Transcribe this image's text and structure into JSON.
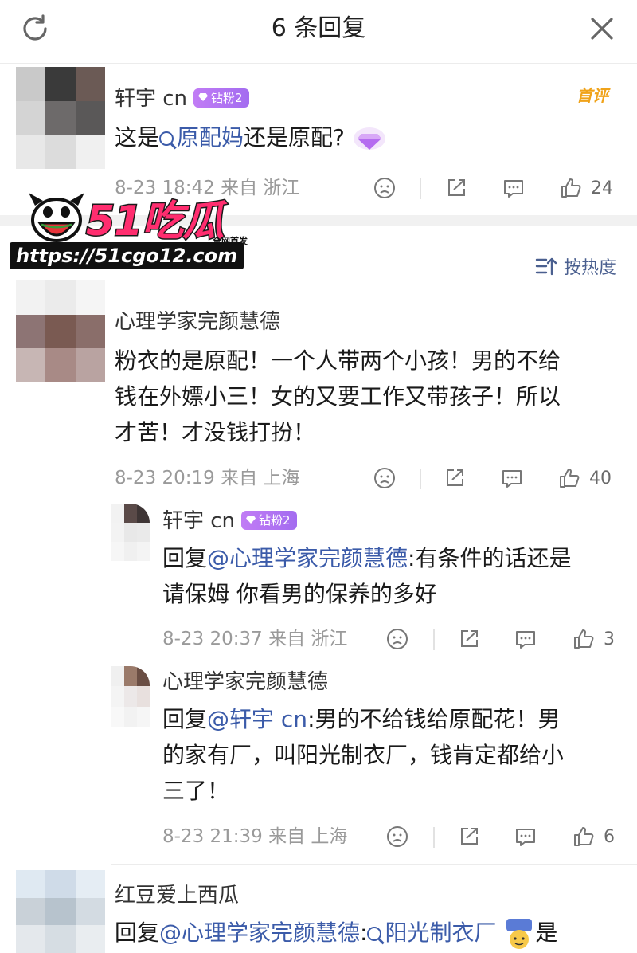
{
  "header": {
    "title": "6 条回复"
  },
  "first_comment": {
    "username": "轩宇 cn",
    "badge": "钻粉2",
    "tag": "首评",
    "text_prefix": "这是",
    "text_link": "原配妈",
    "text_suffix": "还是原配?",
    "meta": "8-23 18:42 来自 浙江",
    "likes": "24"
  },
  "watermark": {
    "brand": "51吃瓜",
    "tag": "全网首发",
    "url": "https://51cgo12.com"
  },
  "sort": {
    "label": "按热度"
  },
  "main_comment": {
    "username": "心理学家完颜慧德",
    "text_line1": "粉衣的是原配！一个人带两个小孩！男的不给",
    "text_line2": "钱在外嫖小三！女的又要工作又带孩子！所以",
    "text_line3": "才苦！才没钱打扮！",
    "meta": "8-23 20:19 来自 上海",
    "likes": "40"
  },
  "reply1": {
    "username": "轩宇 cn",
    "badge": "钻粉2",
    "prefix": "回复",
    "mention": "@心理学家完颜慧德",
    "text_line1_rest": ":有条件的话还是",
    "text_line2": "请保姆 你看男的保养的多好",
    "meta": "8-23 20:37 来自 浙江",
    "likes": "3"
  },
  "reply2": {
    "username": "心理学家完颜慧德",
    "prefix": "回复",
    "mention": "@轩宇 cn",
    "text_line1_rest": ":男的不给钱给原配花！男",
    "text_line2": "的家有厂，叫阳光制衣厂，钱肯定都给小",
    "text_line3": "三了！",
    "meta": "8-23 21:39 来自 上海",
    "likes": "6"
  },
  "reply3": {
    "username": "红豆爱上西瓜",
    "prefix": "回复",
    "mention": "@心理学家完颜慧德",
    "colon": ":",
    "link": "阳光制衣厂",
    "suffix": "是"
  },
  "colors": {
    "link": "#3b5ba9",
    "badge": "#b274f2",
    "first_tag": "#f0a31a",
    "brand": "#ff2d6f"
  }
}
